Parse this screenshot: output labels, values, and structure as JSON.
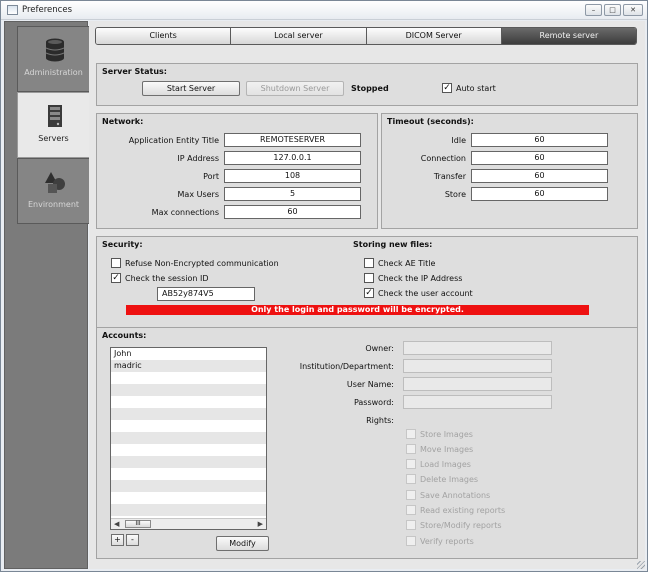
{
  "window": {
    "title": "Preferences",
    "minimize": "–",
    "maximize": "□",
    "close": "✕"
  },
  "sidebar": {
    "items": [
      {
        "label": "Administration",
        "icon": "database-icon",
        "active": false
      },
      {
        "label": "Servers",
        "icon": "server-icon",
        "active": true
      },
      {
        "label": "Environment",
        "icon": "shapes-icon",
        "active": false
      }
    ]
  },
  "tabs": [
    "Clients",
    "Local server",
    "DICOM Server",
    "Remote server"
  ],
  "active_tab": "Remote server",
  "server_status": {
    "title": "Server Status:",
    "start_label": "Start Server",
    "shutdown_label": "Shutdown Server",
    "status_text": "Stopped",
    "auto_start_label": "Auto start",
    "auto_start_checked": true
  },
  "network": {
    "title": "Network:",
    "fields": [
      {
        "label": "Application Entity Title",
        "value": "REMOTESERVER"
      },
      {
        "label": "IP Address",
        "value": "127.0.0.1"
      },
      {
        "label": "Port",
        "value": "108"
      },
      {
        "label": "Max Users",
        "value": "5"
      },
      {
        "label": "Max connections",
        "value": "60"
      }
    ]
  },
  "timeout": {
    "title": "Timeout (seconds):",
    "fields": [
      {
        "label": "Idle",
        "value": "60"
      },
      {
        "label": "Connection",
        "value": "60"
      },
      {
        "label": "Transfer",
        "value": "60"
      },
      {
        "label": "Store",
        "value": "60"
      }
    ]
  },
  "security": {
    "title": "Security:",
    "refuse_label": "Refuse Non-Encrypted communication",
    "refuse_checked": false,
    "check_session_label": "Check the session ID",
    "check_session_checked": true,
    "session_id_value": "AB52y874V5",
    "warning": "Only the login and password will be encrypted."
  },
  "storing": {
    "title": "Storing new files:",
    "options": [
      {
        "label": "Check AE Title",
        "checked": false
      },
      {
        "label": "Check the IP Address",
        "checked": false
      },
      {
        "label": "Check the user account",
        "checked": true
      }
    ]
  },
  "accounts": {
    "title": "Accounts:",
    "list": [
      "John",
      "madric"
    ],
    "scroll_thumb": "III",
    "add_label": "+",
    "remove_label": "-",
    "modify_label": "Modify",
    "owner_label": "Owner:",
    "institution_label": "Institution/Department:",
    "username_label": "User Name:",
    "password_label": "Password:",
    "rights_label": "Rights:",
    "rights": [
      "Store Images",
      "Move Images",
      "Load Images",
      "Delete Images",
      "Save Annotations",
      "Read existing reports",
      "Store/Modify reports",
      "Verify reports"
    ]
  },
  "colors": {
    "warning_bg": "#ee1111",
    "active_tab_bg": "#4a4a4a",
    "sidebar_bg": "#7b7b7b"
  }
}
